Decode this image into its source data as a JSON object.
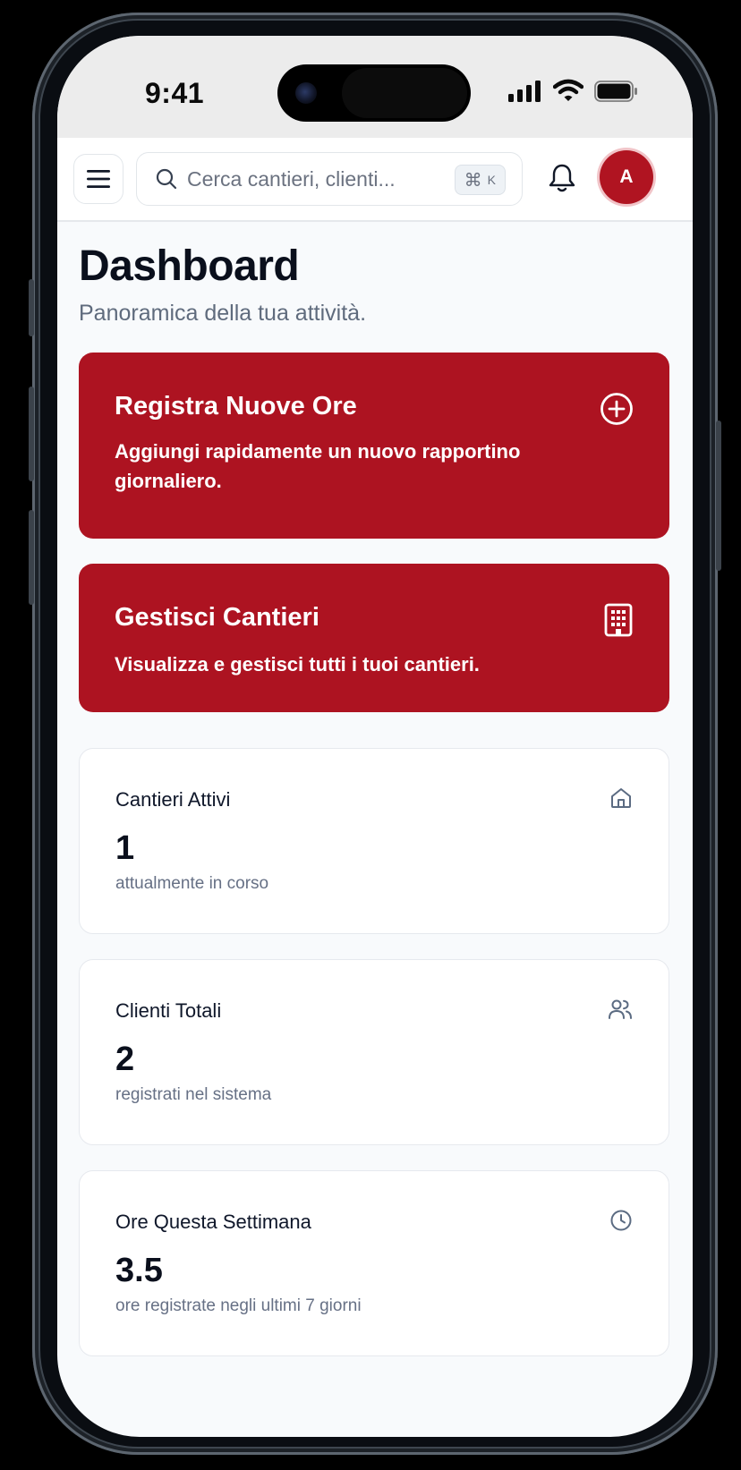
{
  "status_bar": {
    "time": "9:41"
  },
  "header": {
    "search_placeholder": "Cerca cantieri, clienti...",
    "shortcut_symbol": "⌘",
    "shortcut_key": "K",
    "avatar_initial": "A"
  },
  "page": {
    "title": "Dashboard",
    "subtitle": "Panoramica della tua attività."
  },
  "actions": [
    {
      "title": "Registra Nuove Ore",
      "description": "Aggiungi rapidamente un nuovo rapportino giornaliero.",
      "icon": "plus-circle-icon"
    },
    {
      "title": "Gestisci Cantieri",
      "description": "Visualizza e gestisci tutti i tuoi cantieri.",
      "icon": "building-icon"
    }
  ],
  "stats": [
    {
      "label": "Cantieri Attivi",
      "value": "1",
      "description": "attualmente in corso",
      "icon": "home-icon"
    },
    {
      "label": "Clienti Totali",
      "value": "2",
      "description": "registrati nel sistema",
      "icon": "users-icon"
    },
    {
      "label": "Ore Questa Settimana",
      "value": "3.5",
      "description": "ore registrate negli ultimi 7 giorni",
      "icon": "clock-icon"
    }
  ],
  "colors": {
    "accent": "#ad1321",
    "background": "#f8fafc",
    "text_primary": "#0a0f1c",
    "text_muted": "#667085"
  }
}
